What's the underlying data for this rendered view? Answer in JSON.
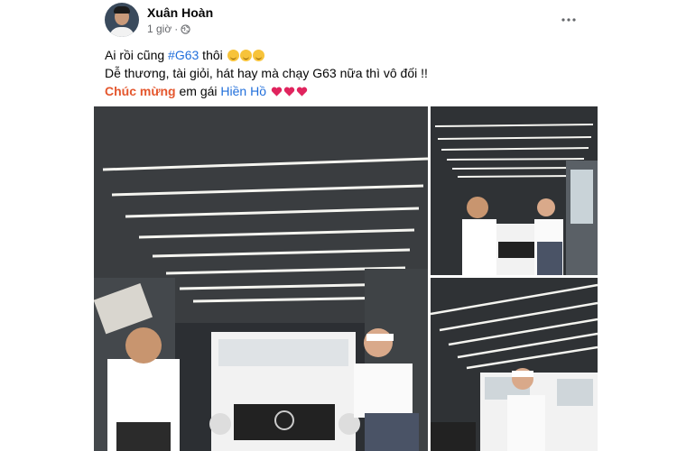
{
  "post": {
    "author": "Xuân Hoàn",
    "time": "1 giờ",
    "line1": {
      "prefix": "Ai rồi cũng ",
      "hashtag": "#G63",
      "suffix": " thôi"
    },
    "line2": "Dễ thương, tài giỏi, hát hay mà chạy G63 nữa thì vô đối !!",
    "line3": {
      "bold": "Chúc mừng",
      "middle": " em gái ",
      "mention": "Hiền Hồ"
    }
  },
  "icons": {
    "globe": "globe-icon",
    "more": "more-horizontal-icon",
    "emoji": "smiling-face-emoji",
    "heart": "red-heart-emoji"
  },
  "colors": {
    "link": "#216fdb",
    "highlight": "#e4572e",
    "heart": "#e0245e",
    "meta": "#65676b"
  }
}
